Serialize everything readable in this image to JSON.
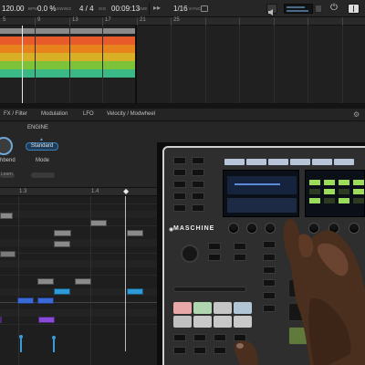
{
  "transport": {
    "tempo": "120.00",
    "tempo_unit": "BPM",
    "swing": "0.0 %",
    "swing_label": "SWING",
    "sig": "4 / 4",
    "sig_label": "SIG",
    "time": "00:09:13",
    "time_label": "TIME",
    "grid": "1/16",
    "grid_label": "SYNC",
    "icon_names": [
      "forward-icon",
      "lock-icon",
      "speaker-icon",
      "meter-icon",
      "power-icon",
      "layout-icon"
    ]
  },
  "ruler": {
    "numbers": [
      "5",
      "9",
      "13",
      "17",
      "21",
      "25"
    ],
    "accent": "#e8e8e8"
  },
  "arrange": {
    "clips": [
      {
        "color": "#e85a2a"
      },
      {
        "color": "#e8821c"
      },
      {
        "color": "#d8b026"
      },
      {
        "color": "#7cc33a"
      },
      {
        "color": "#3ab886"
      }
    ]
  },
  "tabs": {
    "items": [
      "FX / Filter",
      "Modulation",
      "LFO",
      "Velocity / Modwheel"
    ],
    "selected": "FX / Filter"
  },
  "engine": {
    "heading": "ENGINE",
    "mode_value": "Standard",
    "mode_label": "Mode",
    "pitchbend_label": "hbend",
    "learn_label": "Learn"
  },
  "piano_roll": {
    "ruler": [
      "1.3",
      "1.4"
    ]
  },
  "hardware": {
    "brand": "MASCHINE",
    "pad_colors": [
      "#e8a8a8",
      "#b0d6b0",
      "#c6c6c6",
      "#b0c6d6",
      "#c0c0c0",
      "#c8c8c8",
      "#c8c8c8",
      "#c8c8c8"
    ],
    "screen_accent": "#9bdc5a"
  }
}
